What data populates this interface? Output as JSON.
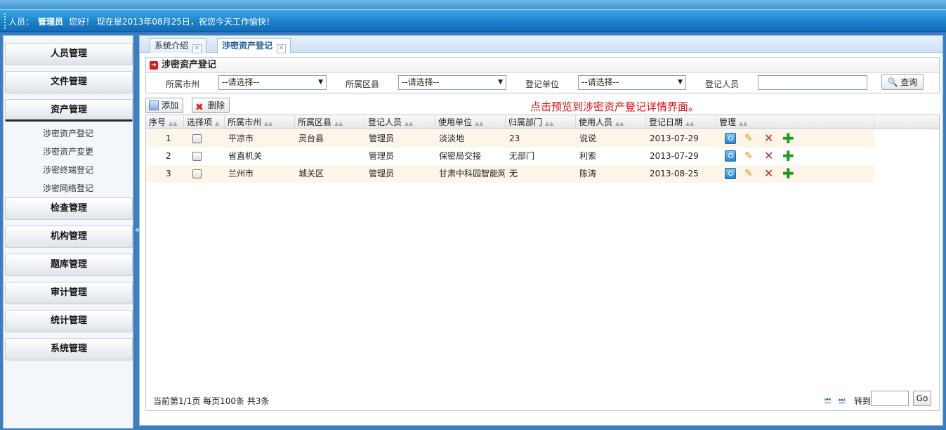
{
  "header": {
    "user_label": "人员：",
    "user_name": "管理员",
    "greeting": "您好！  现在是2013年08月25日，祝您今天工作愉快！"
  },
  "sidebar": {
    "menus": [
      {
        "label": "人员管理"
      },
      {
        "label": "文件管理"
      },
      {
        "label": "资产管理"
      },
      {
        "label": "检查管理"
      },
      {
        "label": "机构管理"
      },
      {
        "label": "题库管理"
      },
      {
        "label": "审计管理"
      },
      {
        "label": "统计管理"
      },
      {
        "label": "系统管理"
      }
    ],
    "asset_submenu": [
      "涉密资产登记",
      "涉密资产变更",
      "涉密终端登记",
      "涉密网络登记"
    ],
    "collapse_glyph": "«"
  },
  "tabs": [
    {
      "label": "系统介绍"
    },
    {
      "label": "涉密资产登记"
    }
  ],
  "search": {
    "title": "涉密资产登记",
    "city_label": "所属市州",
    "city_value": "--请选择--",
    "county_label": "所属区县",
    "county_value": "--请选择--",
    "unit_label": "登记单位",
    "unit_value": "--请选择--",
    "person_label": "登记人员",
    "person_value": "",
    "query_label": "查询"
  },
  "toolbar": {
    "add_label": "添加",
    "delete_label": "删除"
  },
  "annotation": "点击预览到涉密资产登记详情界面。",
  "table": {
    "columns": [
      "序号",
      "选择项",
      "所属市州",
      "所属区县",
      "登记人员",
      "使用单位",
      "归属部门",
      "使用人员",
      "登记日期",
      "管理"
    ],
    "rows": [
      [
        "1",
        "",
        "平凉市",
        "灵台县",
        "管理员",
        "淡淡地",
        "23",
        "说说",
        "2013-07-29"
      ],
      [
        "2",
        "",
        "省直机关",
        "",
        "管理员",
        "保密局交接",
        "无部门",
        "利索",
        "2013-07-29"
      ],
      [
        "3",
        "",
        "兰州市",
        "城关区",
        "管理员",
        "甘肃中科园智能网",
        "无",
        "陈涛",
        "2013-08-25"
      ]
    ]
  },
  "pager": {
    "info": "当前第1/1页  每页100条  共3条",
    "first_glyph": "⏮",
    "last_glyph": "⏭",
    "goto_label": "转到",
    "go_label": "Go"
  }
}
